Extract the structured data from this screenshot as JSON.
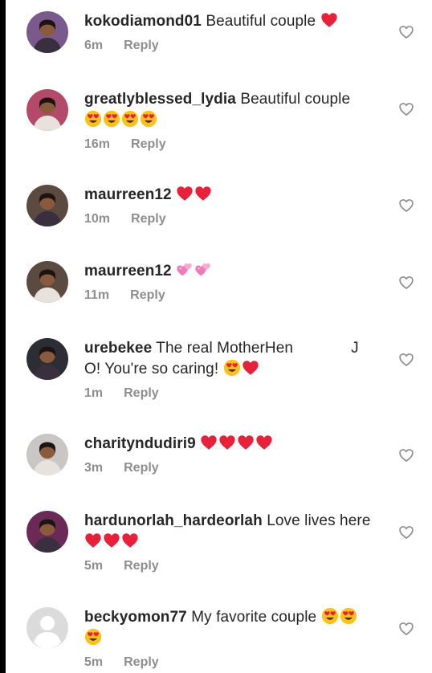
{
  "comments": [
    {
      "username": "kokodiamond01",
      "text": "Beautiful couple",
      "emoji_inline": [
        "red-heart"
      ],
      "emoji_line2": [],
      "time": "6m",
      "reply": "Reply",
      "avatar_color": "#7a5a8c"
    },
    {
      "username": "greatlyblessed_lydia",
      "text": "Beautiful couple",
      "emoji_inline": [],
      "emoji_line2": [
        "heart-eyes",
        "heart-eyes",
        "heart-eyes",
        "heart-eyes"
      ],
      "time": "16m",
      "reply": "Reply",
      "avatar_color": "#b44a6b"
    },
    {
      "username": "maurreen12",
      "text": "",
      "emoji_inline": [
        "red-heart",
        "red-heart"
      ],
      "emoji_line2": [],
      "time": "10m",
      "reply": "Reply",
      "avatar_color": "#5b4a40"
    },
    {
      "username": "maurreen12",
      "text": "",
      "emoji_inline": [
        "two-hearts",
        "two-hearts"
      ],
      "emoji_line2": [],
      "time": "11m",
      "reply": "Reply",
      "avatar_color": "#5b4a40"
    },
    {
      "username": "urebekee",
      "text": "The real MotherHen",
      "text_tail": "J",
      "line2_text": "O!  You're so caring!",
      "emoji_inline": [],
      "emoji_line2": [
        "heart-eyes",
        "red-heart"
      ],
      "time": "1m",
      "reply": "Reply",
      "avatar_color": "#2d2d35"
    },
    {
      "username": "charityndudiri9",
      "text": "",
      "emoji_inline": [
        "red-heart",
        "red-heart",
        "red-heart",
        "red-heart"
      ],
      "emoji_line2": [],
      "time": "3m",
      "reply": "Reply",
      "avatar_color": "#c9c6c6"
    },
    {
      "username": "hardunorlah_hardeorlah",
      "text": "Love lives here",
      "emoji_inline": [],
      "emoji_line2": [
        "red-heart",
        "red-heart",
        "red-heart"
      ],
      "time": "5m",
      "reply": "Reply",
      "avatar_color": "#6b2a55"
    },
    {
      "username": "beckyomon77",
      "text": "My favorite couple",
      "emoji_inline": [
        "heart-eyes",
        "heart-eyes"
      ],
      "emoji_line2": [
        "heart-eyes"
      ],
      "time": "5m",
      "reply": "Reply",
      "avatar_color": "#d9d9d9",
      "avatar_default": true
    }
  ],
  "icons": {
    "like": "heart-outline-icon",
    "like_color": "#8e8e8e"
  }
}
